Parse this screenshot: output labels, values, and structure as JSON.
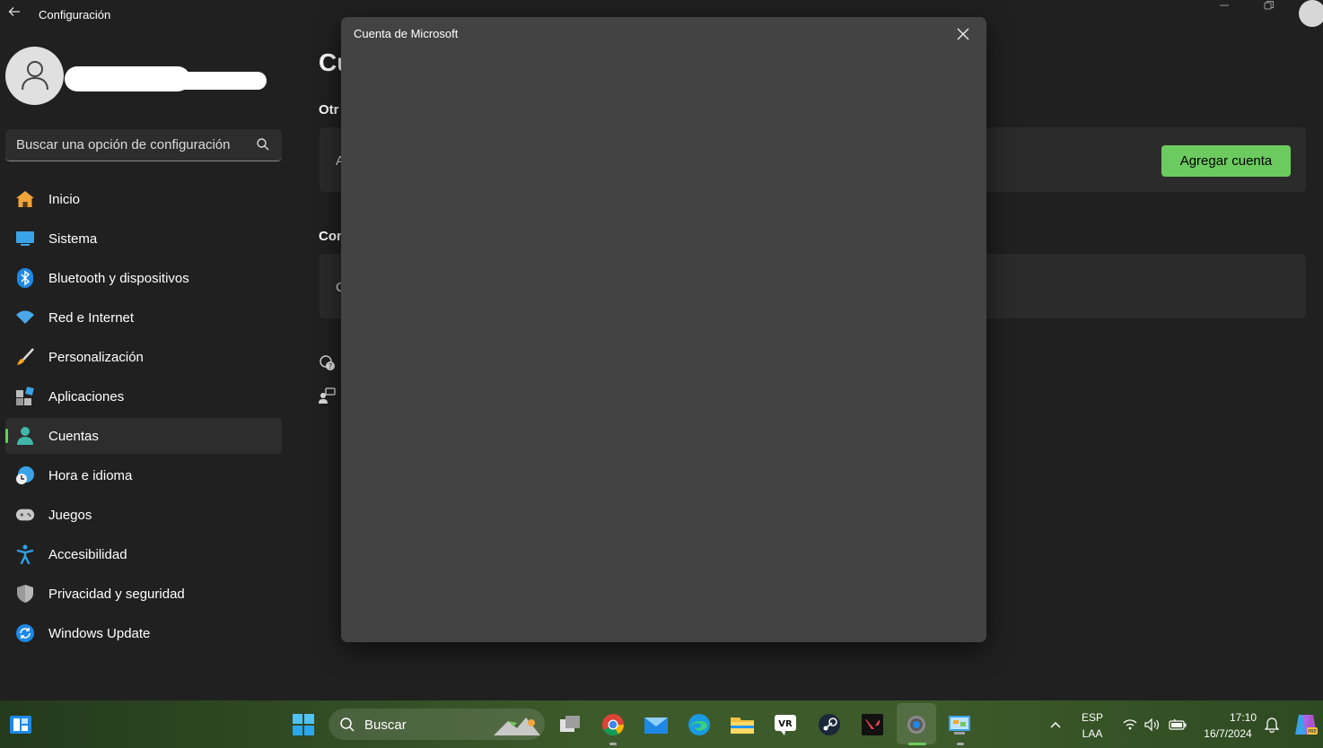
{
  "app": {
    "title": "Configuración"
  },
  "sidebar": {
    "search_placeholder": "Buscar una opción de configuración",
    "items": [
      {
        "label": "Inicio",
        "icon": "home-icon"
      },
      {
        "label": "Sistema",
        "icon": "monitor-icon"
      },
      {
        "label": "Bluetooth y dispositivos",
        "icon": "bluetooth-icon"
      },
      {
        "label": "Red e Internet",
        "icon": "wifi-icon"
      },
      {
        "label": "Personalización",
        "icon": "brush-icon"
      },
      {
        "label": "Aplicaciones",
        "icon": "apps-icon"
      },
      {
        "label": "Cuentas",
        "icon": "person-icon",
        "active": true
      },
      {
        "label": "Hora e idioma",
        "icon": "globe-clock-icon"
      },
      {
        "label": "Juegos",
        "icon": "gamepad-icon"
      },
      {
        "label": "Accesibilidad",
        "icon": "accessibility-icon"
      },
      {
        "label": "Privacidad y seguridad",
        "icon": "shield-icon"
      },
      {
        "label": "Windows Update",
        "icon": "update-icon"
      }
    ]
  },
  "content": {
    "title_partial": "Cu",
    "section1_partial": "Otr",
    "section2_partial": "Con",
    "card1_partial": "A",
    "card2_partial": "C",
    "add_account_label": "Agregar cuenta"
  },
  "dialog": {
    "title": "Cuenta de Microsoft"
  },
  "taskbar": {
    "search_label": "Buscar",
    "lang_line1": "ESP",
    "lang_line2": "LAA",
    "time": "17:10",
    "date": "16/7/2024"
  },
  "colors": {
    "accent": "#6ccb5f",
    "dialog_bg": "#434343",
    "window_bg": "#202020"
  }
}
